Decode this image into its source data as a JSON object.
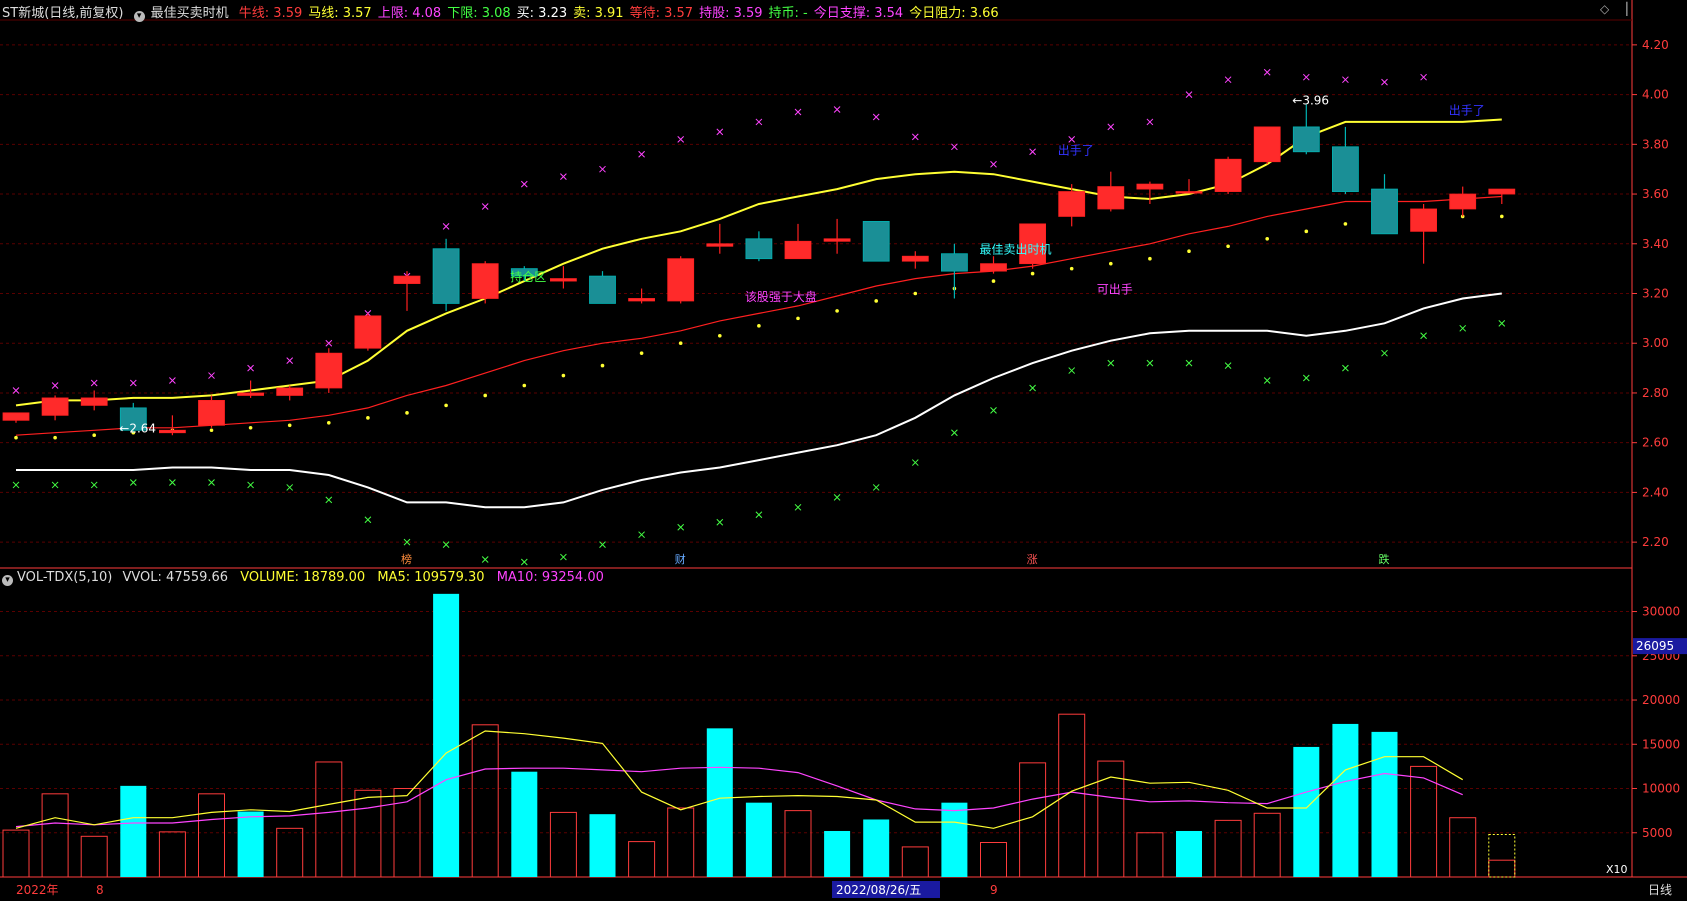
{
  "header": {
    "symbol": "ST新城",
    "mode": "(日线,前复权)",
    "indicator": "最佳买卖时机",
    "items": [
      {
        "label": "牛线:",
        "value": "3.59",
        "color": "#ff3c3c"
      },
      {
        "label": "马线:",
        "value": "3.57",
        "color": "#ffff33"
      },
      {
        "label": "上限:",
        "value": "4.08",
        "color": "#ff44ff"
      },
      {
        "label": "下限:",
        "value": "3.08",
        "color": "#44ff44"
      },
      {
        "label": "买:",
        "value": "3.23",
        "color": "#ffffff"
      },
      {
        "label": "卖:",
        "value": "3.91",
        "color": "#ffff33"
      },
      {
        "label": "等待:",
        "value": "3.57",
        "color": "#ff3c3c"
      },
      {
        "label": "持股:",
        "value": "3.59",
        "color": "#ff44ff"
      },
      {
        "label": "持币:",
        "value": "-",
        "color": "#44ff44"
      },
      {
        "label": "今日支撑:",
        "value": "3.54",
        "color": "#ff44ff"
      },
      {
        "label": "今日阻力:",
        "value": "3.66",
        "color": "#ffff33"
      }
    ]
  },
  "volume_header": {
    "title": "VOL-TDX(5,10)",
    "vvol": "VVOL: 47559.66",
    "volume": "VOLUME: 18789.00",
    "ma5": "MA5: 109579.30",
    "ma10": "MA10: 93254.00"
  },
  "bottom_axis": {
    "year": "2022年",
    "month1": "8",
    "cursor_date": "2022/08/26/五",
    "month2": "9",
    "period": "日线"
  },
  "x10_label": "X10",
  "cursor_value": "26095",
  "markers": [
    "榜",
    "财",
    "涨",
    "跌"
  ],
  "colors": {
    "up": "#ff2020",
    "down": "#00b3b3",
    "grid": "#5a0000",
    "axis": "#ff3c3c"
  },
  "chart_data": [
    {
      "type": "candlestick",
      "ylim": [
        2.1,
        4.3
      ],
      "yticks": [
        "4.20",
        "4.00",
        "3.80",
        "3.60",
        "3.40",
        "3.20",
        "3.00",
        "2.80",
        "2.60",
        "2.40",
        "2.20"
      ],
      "candles": [
        {
          "o": 2.69,
          "h": 2.72,
          "l": 2.68,
          "c": 2.72
        },
        {
          "o": 2.71,
          "h": 2.79,
          "l": 2.69,
          "c": 2.78
        },
        {
          "o": 2.75,
          "h": 2.81,
          "l": 2.73,
          "c": 2.78
        },
        {
          "o": 2.74,
          "h": 2.76,
          "l": 2.64,
          "c": 2.65
        },
        {
          "o": 2.64,
          "h": 2.71,
          "l": 2.63,
          "c": 2.65
        },
        {
          "o": 2.67,
          "h": 2.79,
          "l": 2.66,
          "c": 2.77
        },
        {
          "o": 2.79,
          "h": 2.85,
          "l": 2.78,
          "c": 2.8
        },
        {
          "o": 2.79,
          "h": 2.83,
          "l": 2.77,
          "c": 2.82
        },
        {
          "o": 2.82,
          "h": 2.98,
          "l": 2.8,
          "c": 2.96
        },
        {
          "o": 2.98,
          "h": 3.12,
          "l": 2.97,
          "c": 3.11
        },
        {
          "o": 3.24,
          "h": 3.29,
          "l": 3.13,
          "c": 3.27
        },
        {
          "o": 3.38,
          "h": 3.42,
          "l": 3.13,
          "c": 3.16
        },
        {
          "o": 3.18,
          "h": 3.33,
          "l": 3.16,
          "c": 3.32
        },
        {
          "o": 3.3,
          "h": 3.31,
          "l": 3.25,
          "c": 3.27
        },
        {
          "o": 3.25,
          "h": 3.31,
          "l": 3.22,
          "c": 3.26
        },
        {
          "o": 3.27,
          "h": 3.29,
          "l": 3.16,
          "c": 3.16
        },
        {
          "o": 3.17,
          "h": 3.22,
          "l": 3.16,
          "c": 3.18
        },
        {
          "o": 3.17,
          "h": 3.35,
          "l": 3.16,
          "c": 3.34
        },
        {
          "o": 3.39,
          "h": 3.48,
          "l": 3.36,
          "c": 3.4
        },
        {
          "o": 3.42,
          "h": 3.45,
          "l": 3.33,
          "c": 3.34
        },
        {
          "o": 3.34,
          "h": 3.48,
          "l": 3.34,
          "c": 3.41
        },
        {
          "o": 3.41,
          "h": 3.5,
          "l": 3.36,
          "c": 3.42
        },
        {
          "o": 3.49,
          "h": 3.49,
          "l": 3.33,
          "c": 3.33
        },
        {
          "o": 3.33,
          "h": 3.37,
          "l": 3.3,
          "c": 3.35
        },
        {
          "o": 3.36,
          "h": 3.4,
          "l": 3.18,
          "c": 3.29
        },
        {
          "o": 3.29,
          "h": 3.35,
          "l": 3.28,
          "c": 3.32
        },
        {
          "o": 3.32,
          "h": 3.48,
          "l": 3.3,
          "c": 3.48
        },
        {
          "o": 3.51,
          "h": 3.64,
          "l": 3.47,
          "c": 3.61
        },
        {
          "o": 3.54,
          "h": 3.69,
          "l": 3.53,
          "c": 3.63
        },
        {
          "o": 3.62,
          "h": 3.65,
          "l": 3.56,
          "c": 3.64
        },
        {
          "o": 3.61,
          "h": 3.66,
          "l": 3.61,
          "c": 3.61
        },
        {
          "o": 3.61,
          "h": 3.75,
          "l": 3.6,
          "c": 3.74
        },
        {
          "o": 3.73,
          "h": 3.87,
          "l": 3.72,
          "c": 3.87
        },
        {
          "o": 3.87,
          "h": 3.96,
          "l": 3.76,
          "c": 3.77
        },
        {
          "o": 3.79,
          "h": 3.87,
          "l": 3.6,
          "c": 3.61
        },
        {
          "o": 3.62,
          "h": 3.68,
          "l": 3.44,
          "c": 3.44
        },
        {
          "o": 3.45,
          "h": 3.56,
          "l": 3.32,
          "c": 3.54
        },
        {
          "o": 3.54,
          "h": 3.63,
          "l": 3.51,
          "c": 3.6
        },
        {
          "o": 3.6,
          "h": 3.62,
          "l": 3.56,
          "c": 3.62
        }
      ],
      "lines": {
        "yellow": [
          2.75,
          2.77,
          2.77,
          2.78,
          2.78,
          2.79,
          2.81,
          2.83,
          2.85,
          2.93,
          3.05,
          3.12,
          3.18,
          3.25,
          3.32,
          3.38,
          3.42,
          3.45,
          3.5,
          3.56,
          3.59,
          3.62,
          3.66,
          3.68,
          3.69,
          3.68,
          3.65,
          3.62,
          3.59,
          3.58,
          3.6,
          3.64,
          3.72,
          3.83,
          3.89,
          3.89,
          3.89,
          3.89,
          3.9
        ],
        "red": [
          2.63,
          2.64,
          2.65,
          2.66,
          2.66,
          2.67,
          2.68,
          2.69,
          2.71,
          2.74,
          2.79,
          2.83,
          2.88,
          2.93,
          2.97,
          3.0,
          3.02,
          3.05,
          3.09,
          3.12,
          3.15,
          3.19,
          3.23,
          3.26,
          3.28,
          3.29,
          3.31,
          3.34,
          3.37,
          3.4,
          3.44,
          3.47,
          3.51,
          3.54,
          3.57,
          3.57,
          3.57,
          3.58,
          3.59
        ],
        "white": [
          2.49,
          2.49,
          2.49,
          2.49,
          2.5,
          2.5,
          2.49,
          2.49,
          2.47,
          2.42,
          2.36,
          2.36,
          2.34,
          2.34,
          2.36,
          2.41,
          2.45,
          2.48,
          2.5,
          2.53,
          2.56,
          2.59,
          2.63,
          2.7,
          2.79,
          2.86,
          2.92,
          2.97,
          3.01,
          3.04,
          3.05,
          3.05,
          3.05,
          3.03,
          3.05,
          3.08,
          3.14,
          3.18,
          3.2
        ],
        "dots_yellow": [
          2.62,
          2.62,
          2.63,
          2.64,
          2.65,
          2.65,
          2.66,
          2.67,
          2.68,
          2.7,
          2.72,
          2.75,
          2.79,
          2.83,
          2.87,
          2.91,
          2.96,
          3.0,
          3.03,
          3.07,
          3.1,
          3.13,
          3.17,
          3.2,
          3.22,
          3.25,
          3.28,
          3.3,
          3.32,
          3.34,
          3.37,
          3.39,
          3.42,
          3.45,
          3.48,
          3.5,
          3.5,
          3.51,
          3.51
        ],
        "upper_x": [
          2.81,
          2.83,
          2.84,
          2.84,
          2.85,
          2.87,
          2.9,
          2.93,
          3.0,
          3.12,
          3.27,
          3.47,
          3.55,
          3.64,
          3.67,
          3.7,
          3.76,
          3.82,
          3.85,
          3.89,
          3.93,
          3.94,
          3.91,
          3.83,
          3.79,
          3.72,
          3.77,
          3.82,
          3.87,
          3.89,
          4.0,
          4.06,
          4.09,
          4.07,
          4.06,
          4.05,
          4.07
        ],
        "lower_x": [
          2.43,
          2.43,
          2.43,
          2.44,
          2.44,
          2.44,
          2.43,
          2.42,
          2.37,
          2.29,
          2.2,
          2.19,
          2.13,
          2.12,
          2.14,
          2.19,
          2.23,
          2.26,
          2.28,
          2.31,
          2.34,
          2.38,
          2.42,
          2.52,
          2.64,
          2.73,
          2.82,
          2.89,
          2.92,
          2.92,
          2.92,
          2.91,
          2.85,
          2.86,
          2.9,
          2.96,
          3.03,
          3.06,
          3.08
        ]
      },
      "annotations": [
        {
          "i": 3,
          "y": 2.64,
          "text": "←2.64",
          "color": "#ffffff"
        },
        {
          "i": 33,
          "y": 3.96,
          "text": "←3.96",
          "color": "#ffffff"
        },
        {
          "i": 13,
          "y": 3.25,
          "text": "持仓区",
          "color": "#44ff44"
        },
        {
          "i": 19,
          "y": 3.17,
          "text": "该股强于大盘",
          "color": "#ff44ff"
        },
        {
          "i": 25,
          "y": 3.36,
          "text": "最佳卖出时机",
          "color": "#33ffff"
        },
        {
          "i": 27,
          "y": 3.76,
          "text": "出手了",
          "color": "#3333ff"
        },
        {
          "i": 28,
          "y": 3.2,
          "text": "可出手",
          "color": "#ff44ff"
        },
        {
          "i": 37,
          "y": 3.92,
          "text": "出手了",
          "color": "#3333ff"
        }
      ]
    },
    {
      "type": "bar",
      "title": "VOL-TDX(5,10)",
      "ylim": [
        0,
        33000
      ],
      "yticks": [
        "30000",
        "25000",
        "20000",
        "15000",
        "10000",
        "5000"
      ],
      "values": [
        5300,
        9400,
        4600,
        10300,
        5100,
        9400,
        7400,
        5500,
        13000,
        9800,
        10000,
        32000,
        17200,
        11900,
        7300,
        7100,
        4000,
        7800,
        16800,
        8400,
        7500,
        5200,
        6500,
        3400,
        8400,
        3900,
        12900,
        18400,
        13100,
        5000,
        5200,
        6400,
        7200,
        14700,
        17300,
        16400,
        12500,
        6700,
        1900
      ],
      "up": [
        true,
        true,
        true,
        false,
        true,
        true,
        false,
        true,
        true,
        true,
        true,
        false,
        true,
        false,
        true,
        false,
        true,
        true,
        false,
        false,
        true,
        false,
        false,
        true,
        false,
        true,
        true,
        true,
        true,
        true,
        false,
        true,
        true,
        false,
        false,
        false,
        true,
        true,
        true
      ],
      "ma5": [
        5500,
        6700,
        5900,
        6700,
        6700,
        7300,
        7600,
        7400,
        8200,
        9000,
        9200,
        14000,
        16500,
        16200,
        15700,
        15100,
        9600,
        7600,
        8900,
        9100,
        9200,
        9100,
        8700,
        6200,
        6200,
        5500,
        6800,
        9700,
        11300,
        10600,
        10700,
        9800,
        7800,
        7800,
        12100,
        13600,
        13600,
        11000
      ],
      "ma10": [
        5700,
        6100,
        5900,
        6100,
        6100,
        6500,
        6800,
        6900,
        7300,
        7800,
        8500,
        11000,
        12200,
        12300,
        12300,
        12100,
        11900,
        12300,
        12400,
        12300,
        11800,
        10300,
        8700,
        7700,
        7500,
        7800,
        8800,
        9600,
        9000,
        8500,
        8600,
        8400,
        8300,
        9600,
        10800,
        11700,
        11200,
        9300
      ]
    }
  ]
}
